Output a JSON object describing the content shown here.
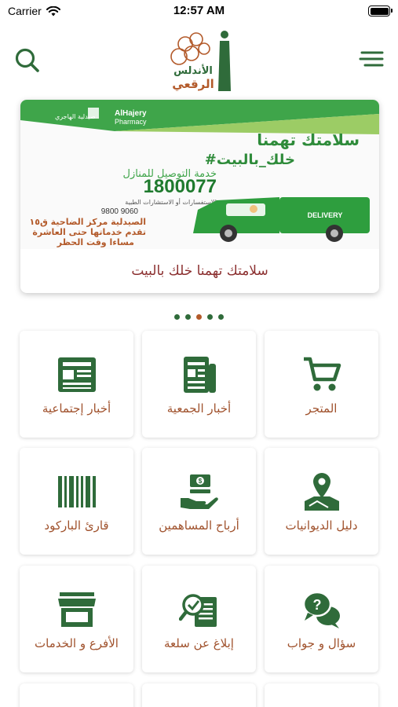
{
  "status_bar": {
    "carrier": "Carrier",
    "time": "12:57 AM"
  },
  "header": {
    "logo_text_line1": "الأندلس",
    "logo_text_line2": "الرقعي"
  },
  "banner": {
    "caption": "سلامتك تهمنا خلك بالبيت",
    "brand_ar": "صيدلية الهاجري",
    "brand_en_1": "AlHajery",
    "brand_en_2": "Pharmacy",
    "headline_1": "سلامتك تهمنا",
    "headline_2": "#خلك_بالبيت",
    "service_line": "خدمة التوصيل للمنازل",
    "phone_big": "1800077",
    "consult_line": "للاستفسارات أو الاستشارات الطبية",
    "whatsapp": "9800 9060",
    "branch_line_1": "الصيدلية مركز الضاحية ق١٥",
    "branch_line_2": "تقدم خدماتها حتى العاشرة",
    "branch_line_3": "مساءا وقت الحظر",
    "truck_label": "DELIVERY",
    "dots_count": 5,
    "active_dot": 3
  },
  "colors": {
    "primary_green": "#2f6b3a",
    "label_brown": "#a0522d",
    "caption_red": "#8b2f2f",
    "accent_orange": "#b35a2a"
  },
  "tiles": [
    {
      "label": "المتجر",
      "icon": "cart-icon"
    },
    {
      "label": "أخبار الجمعية",
      "icon": "newspaper-icon"
    },
    {
      "label": "أخبار إجتماعية",
      "icon": "news-icon"
    },
    {
      "label": "دليل الديوانيات",
      "icon": "map-pin-icon"
    },
    {
      "label": "أرباح المساهمين",
      "icon": "money-hand-icon"
    },
    {
      "label": "قارئ الباركود",
      "icon": "barcode-icon"
    },
    {
      "label": "سؤال و جواب",
      "icon": "question-chat-icon"
    },
    {
      "label": "إبلاغ عن سلعة",
      "icon": "report-product-icon"
    },
    {
      "label": "الأفرع و الخدمات",
      "icon": "store-icon"
    }
  ]
}
